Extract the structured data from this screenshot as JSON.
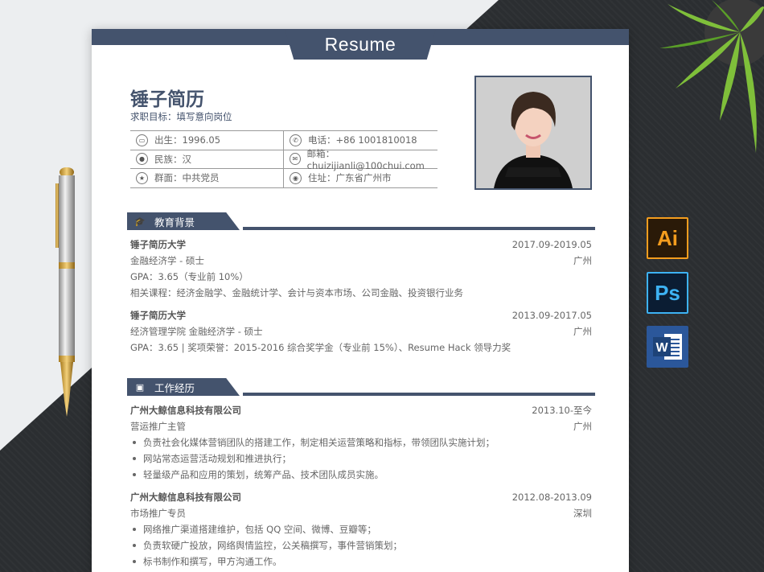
{
  "header": {
    "tab_title": "Resume"
  },
  "profile": {
    "name": "锤子简历",
    "objective": "求职目标：填写意向岗位",
    "info": [
      {
        "left": {
          "icon": "id-card-icon",
          "text": "出生：1996.05"
        },
        "right": {
          "icon": "phone-icon",
          "text": "电话：+86 1001810018"
        }
      },
      {
        "left": {
          "icon": "people-icon",
          "text": "民族：汉"
        },
        "right": {
          "icon": "mail-icon",
          "text": "邮箱：chuizijianli@100chui.com"
        }
      },
      {
        "left": {
          "icon": "party-icon",
          "text": "群面：中共党员"
        },
        "right": {
          "icon": "location-icon",
          "text": "住址：广东省广州市"
        }
      }
    ]
  },
  "education": {
    "heading": "教育背景",
    "icon": "graduation-cap-icon",
    "items": [
      {
        "school": "锤子简历大学",
        "date": "2017.09-2019.05",
        "major": "金融经济学 - 硕士",
        "city": "广州",
        "gpa": "GPA：3.65（专业前 10%）",
        "courses": "相关课程：经济金融学、金融统计学、会计与资本市场、公司金融、投资银行业务"
      },
      {
        "school": "锤子简历大学",
        "date": "2013.09-2017.05",
        "major": "经济管理学院 金融经济学 - 硕士",
        "city": "广州",
        "gpa": "GPA：3.65 | 奖项荣誉：2015-2016 综合奖学金（专业前 15%）、Resume Hack 领导力奖"
      }
    ]
  },
  "work": {
    "heading": "工作经历",
    "icon": "briefcase-icon",
    "items": [
      {
        "company": "广州大鲸信息科技有限公司",
        "date": "2013.10-至今",
        "role": "营运推广主管",
        "city": "广州",
        "bullets": [
          "负责社会化媒体营销团队的搭建工作，制定相关运营策略和指标，带领团队实施计划；",
          "网站常态运营活动规划和推进执行；",
          "轻量级产品和应用的策划，统筹产品、技术团队成员实施。"
        ]
      },
      {
        "company": "广州大鲸信息科技有限公司",
        "date": "2012.08-2013.09",
        "role": "市场推广专员",
        "city": "深圳",
        "bullets": [
          "网络推广渠道搭建维护，包括 QQ 空间、微博、豆瓣等；",
          "负责软硬广投放，网络舆情监控，公关稿撰写，事件营销策划；",
          "标书制作和撰写，甲方沟通工作。"
        ]
      }
    ]
  },
  "apps": {
    "ai": "Ai",
    "ps": "Ps",
    "word": "W"
  }
}
